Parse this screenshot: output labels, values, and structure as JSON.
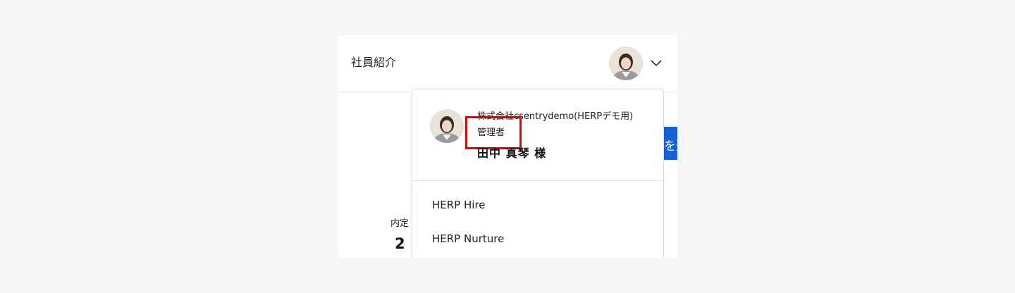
{
  "header": {
    "title": "社員紹介"
  },
  "account_menu": {
    "company": "株式会社csentrydemo(HERPデモ用)",
    "role": "管理者",
    "user_name": "田中 真琴 様",
    "items": [
      {
        "label": "HERP Hire"
      },
      {
        "label": "HERP Nurture"
      }
    ]
  },
  "background": {
    "button_fragment": "を選",
    "stat_label": "内定",
    "stat_value": "2"
  },
  "colors": {
    "accent_blue": "#1560d4",
    "highlight_red": "#e00000",
    "page_background": "#f6f6f6"
  }
}
